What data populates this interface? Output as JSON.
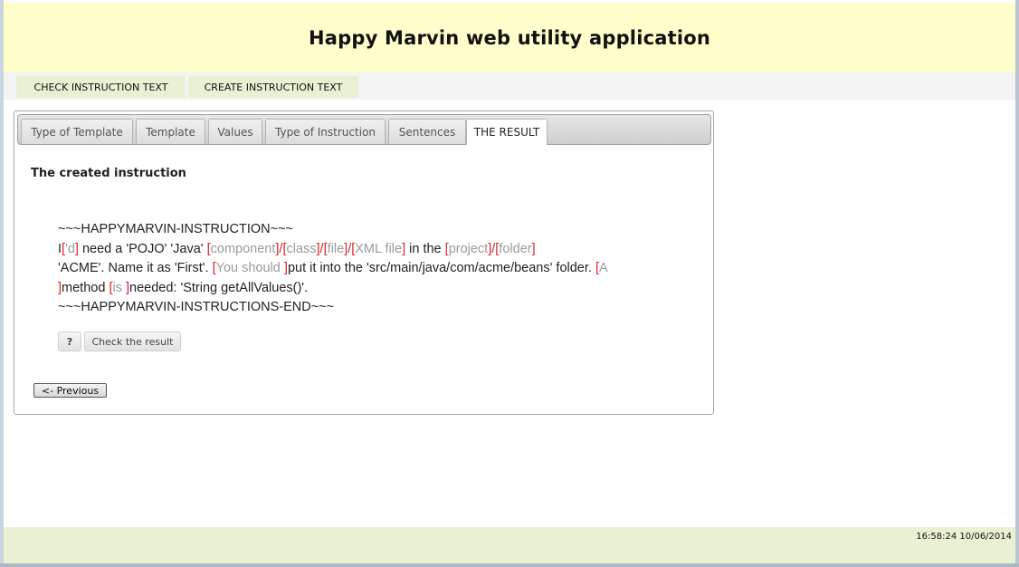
{
  "header": {
    "title": "Happy Marvin web utility application"
  },
  "nav": {
    "check_label": "CHECK INSTRUCTION TEXT",
    "create_label": "CREATE INSTRUCTION TEXT"
  },
  "tabs": [
    {
      "label": "Type of Template",
      "active": false
    },
    {
      "label": "Template",
      "active": false
    },
    {
      "label": "Values",
      "active": false
    },
    {
      "label": "Type of Instruction",
      "active": false
    },
    {
      "label": "Sentences",
      "active": false
    },
    {
      "label": "THE RESULT",
      "active": true
    }
  ],
  "result": {
    "title": "The created instruction",
    "start_marker": "~~~HAPPYMARVIN-INSTRUCTION~~~",
    "end_marker": "~~~HAPPYMARVIN-INSTRUCTIONS-END~~~",
    "line2": {
      "t1": "I",
      "o1": "'d",
      "t2": " need a 'POJO' 'Java' ",
      "o2": "component",
      "o3": "class",
      "o4": "file",
      "o5": "XML file",
      "t3": " in the ",
      "o6": "project",
      "o7": "folder"
    },
    "line3": {
      "t1": "'ACME'. Name it as 'First'. ",
      "o1": "You should ",
      "t2": "put it into the 'src/main/java/com/acme/beans' folder. ",
      "o2": "A"
    },
    "line4": {
      "o1": "is ",
      "t2": "needed: 'String getAllValues()'.",
      "t1": "method "
    },
    "help_label": "?",
    "check_label": "Check the result",
    "previous_label": "<- Previous"
  },
  "footer": {
    "timestamp": "16:58:24 10/06/2014"
  },
  "colors": {
    "header_bg": "#ffffcc",
    "nav_btn_bg": "#e9f1d4",
    "footer_bg": "#eaf1d2",
    "bracket": "#dd2222",
    "optional_text": "#9a9a9a"
  }
}
